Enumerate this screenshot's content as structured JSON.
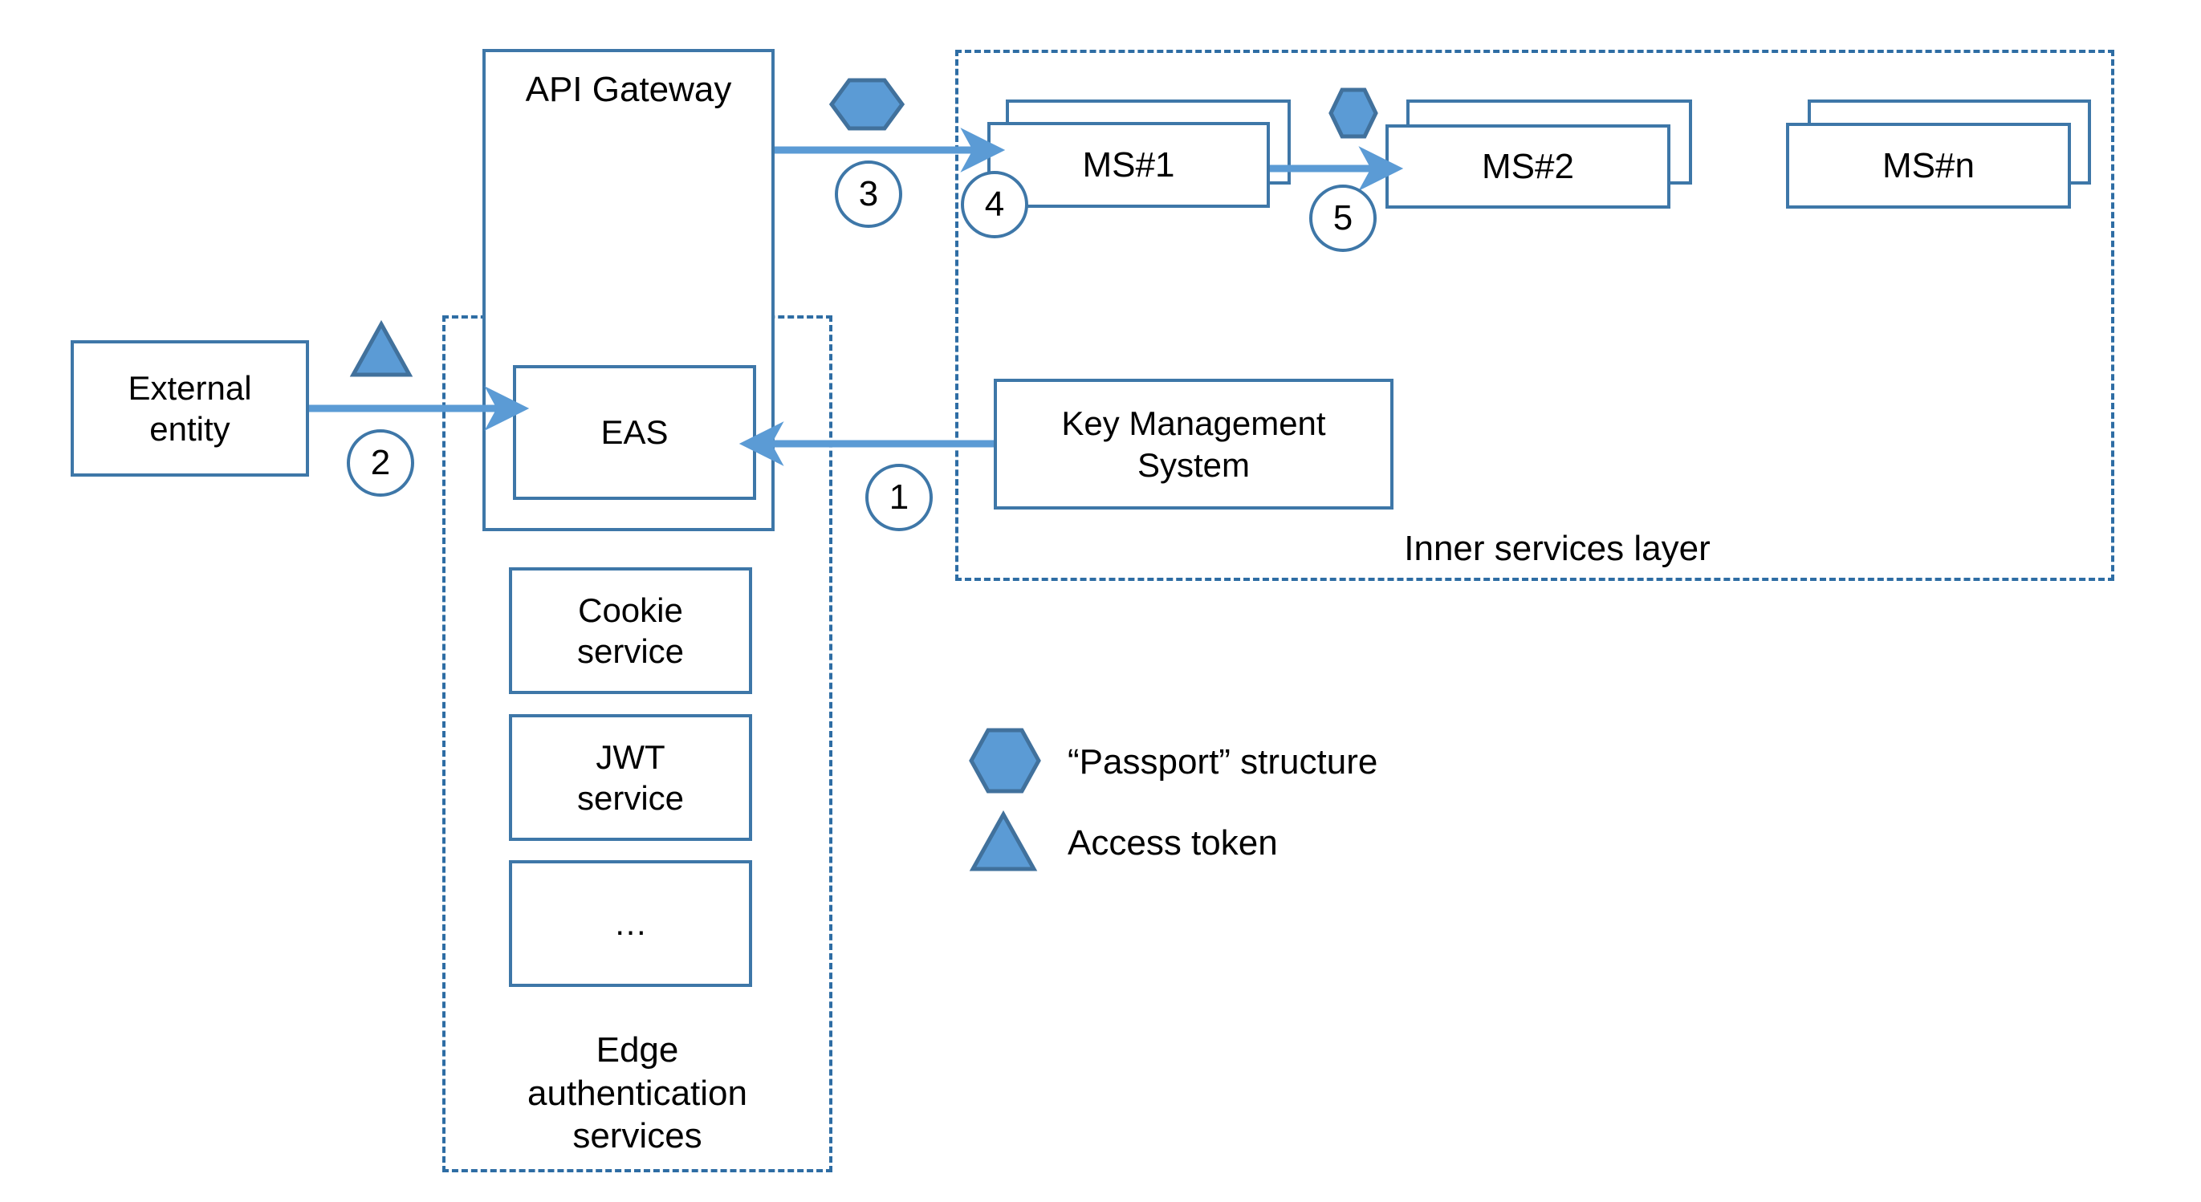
{
  "diagram": {
    "title": "Edge authentication / microservices passport architecture",
    "colors": {
      "shape_fill_blue": "#5B9BD5",
      "shape_border_blue": "#41719C",
      "box_border_blue": "#3E77A8",
      "dashed_border_blue": "#2E6DA4",
      "arrow_blue": "#5B9BD5",
      "text_black": "#000000",
      "background": "#FFFFFF"
    }
  },
  "nodes": {
    "api_gateway": {
      "label": "API Gateway"
    },
    "external_entity": {
      "label": "External\nentity"
    },
    "eas": {
      "label": "EAS"
    },
    "cookie_service": {
      "label": "Cookie\nservice"
    },
    "jwt_service": {
      "label": "JWT\nservice"
    },
    "ellipsis_service": {
      "label": "…"
    },
    "key_management_system": {
      "label": "Key Management\nSystem"
    },
    "ms1": {
      "label": "MS#1"
    },
    "ms2": {
      "label": "MS#2"
    },
    "msn": {
      "label": "MS#n"
    }
  },
  "groups": {
    "edge_authentication_services": {
      "label": "Edge\nauthentication\nservices"
    },
    "inner_services_layer": {
      "label": "Inner services layer"
    }
  },
  "step_markers": [
    {
      "id": "1",
      "label": "1"
    },
    {
      "id": "2",
      "label": "2"
    },
    {
      "id": "3",
      "label": "3"
    },
    {
      "id": "4",
      "label": "4"
    },
    {
      "id": "5",
      "label": "5"
    }
  ],
  "legend": {
    "items": [
      {
        "icon": "hexagon-icon",
        "label": "“Passport” structure"
      },
      {
        "icon": "triangle-icon",
        "label": "Access token"
      }
    ]
  },
  "flows": [
    {
      "step": "1",
      "from": "key_management_system",
      "to": "eas"
    },
    {
      "step": "2",
      "from": "external_entity",
      "to": "eas",
      "marker": "Access token"
    },
    {
      "step": "3",
      "from": "api_gateway",
      "to": "ms1",
      "marker": "“Passport” structure"
    },
    {
      "step": "4",
      "from": "inner_services_layer_boundary",
      "to": "ms1"
    },
    {
      "step": "5",
      "from": "ms1",
      "to": "ms2",
      "marker": "“Passport” structure"
    }
  ]
}
